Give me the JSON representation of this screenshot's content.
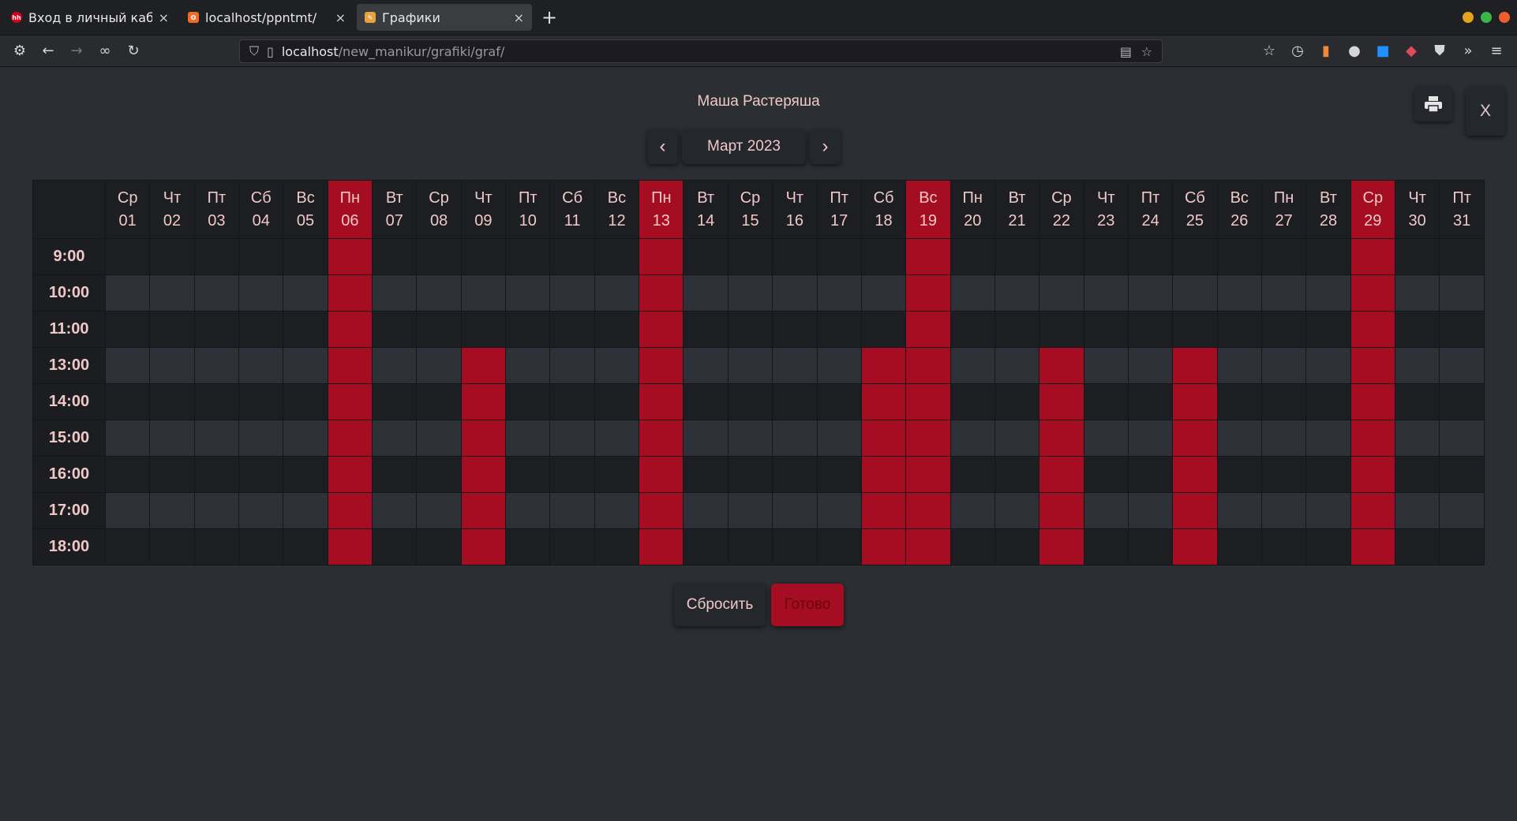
{
  "browser": {
    "tabs": [
      {
        "title": "Вход в личный кабин",
        "favicon": "hh-icon",
        "favicon_color": "#d6001c",
        "active": false
      },
      {
        "title": "localhost/ppntmt/",
        "favicon": "xampp-icon",
        "favicon_color": "#f26b21",
        "active": false
      },
      {
        "title": "Графики",
        "favicon": "page-icon",
        "favicon_color": "#e8a33d",
        "active": true
      }
    ],
    "new_tab": "+",
    "url_host": "localhost",
    "url_path": "/new_manikur/grafiki/graf/"
  },
  "page": {
    "person_name": "Маша Растеряша",
    "month_label": "Март 2023",
    "prev_label": "‹",
    "next_label": "›",
    "close_label": "X",
    "reset_label": "Сбросить",
    "done_label": "Готово"
  },
  "colors": {
    "accent": "#a50d22",
    "background": "#2b2e33"
  },
  "schedule": {
    "times": [
      "9:00",
      "10:00",
      "11:00",
      "13:00",
      "14:00",
      "15:00",
      "16:00",
      "17:00",
      "18:00"
    ],
    "days": [
      {
        "dow": "Ср",
        "num": "01"
      },
      {
        "dow": "Чт",
        "num": "02"
      },
      {
        "dow": "Пт",
        "num": "03"
      },
      {
        "dow": "Сб",
        "num": "04"
      },
      {
        "dow": "Вс",
        "num": "05"
      },
      {
        "dow": "Пн",
        "num": "06"
      },
      {
        "dow": "Вт",
        "num": "07"
      },
      {
        "dow": "Ср",
        "num": "08"
      },
      {
        "dow": "Чт",
        "num": "09"
      },
      {
        "dow": "Пт",
        "num": "10"
      },
      {
        "dow": "Сб",
        "num": "11"
      },
      {
        "dow": "Вс",
        "num": "12"
      },
      {
        "dow": "Пн",
        "num": "13"
      },
      {
        "dow": "Вт",
        "num": "14"
      },
      {
        "dow": "Ср",
        "num": "15"
      },
      {
        "dow": "Чт",
        "num": "16"
      },
      {
        "dow": "Пт",
        "num": "17"
      },
      {
        "dow": "Сб",
        "num": "18"
      },
      {
        "dow": "Вс",
        "num": "19"
      },
      {
        "dow": "Пн",
        "num": "20"
      },
      {
        "dow": "Вт",
        "num": "21"
      },
      {
        "dow": "Ср",
        "num": "22"
      },
      {
        "dow": "Чт",
        "num": "23"
      },
      {
        "dow": "Пт",
        "num": "24"
      },
      {
        "dow": "Сб",
        "num": "25"
      },
      {
        "dow": "Вс",
        "num": "26"
      },
      {
        "dow": "Пн",
        "num": "27"
      },
      {
        "dow": "Вт",
        "num": "28"
      },
      {
        "dow": "Ср",
        "num": "29"
      },
      {
        "dow": "Чт",
        "num": "30"
      },
      {
        "dow": "Пт",
        "num": "31"
      }
    ],
    "full_day_dates": [
      "06",
      "13",
      "19",
      "29"
    ],
    "afternoon_dates": [
      "09",
      "18",
      "22",
      "25"
    ],
    "afternoon_from": "13:00"
  }
}
